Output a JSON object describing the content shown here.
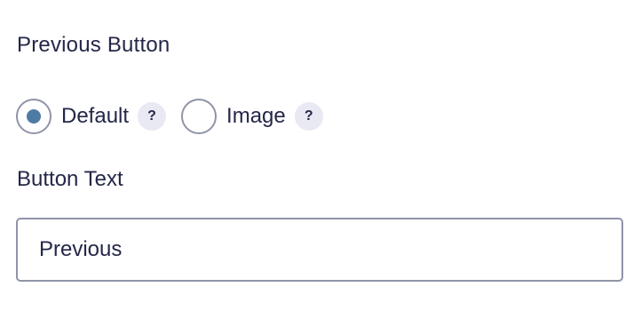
{
  "section": {
    "title": "Previous Button"
  },
  "button_type": {
    "options": [
      {
        "label": "Default",
        "selected": true,
        "help_icon": "?"
      },
      {
        "label": "Image",
        "selected": false,
        "help_icon": "?"
      }
    ]
  },
  "button_text": {
    "label": "Button Text",
    "value": "Previous",
    "placeholder": ""
  },
  "colors": {
    "text": "#242748",
    "radio_selected": "#4d7ba3",
    "border": "#9094a8",
    "help_bg": "#e9e9f3"
  }
}
